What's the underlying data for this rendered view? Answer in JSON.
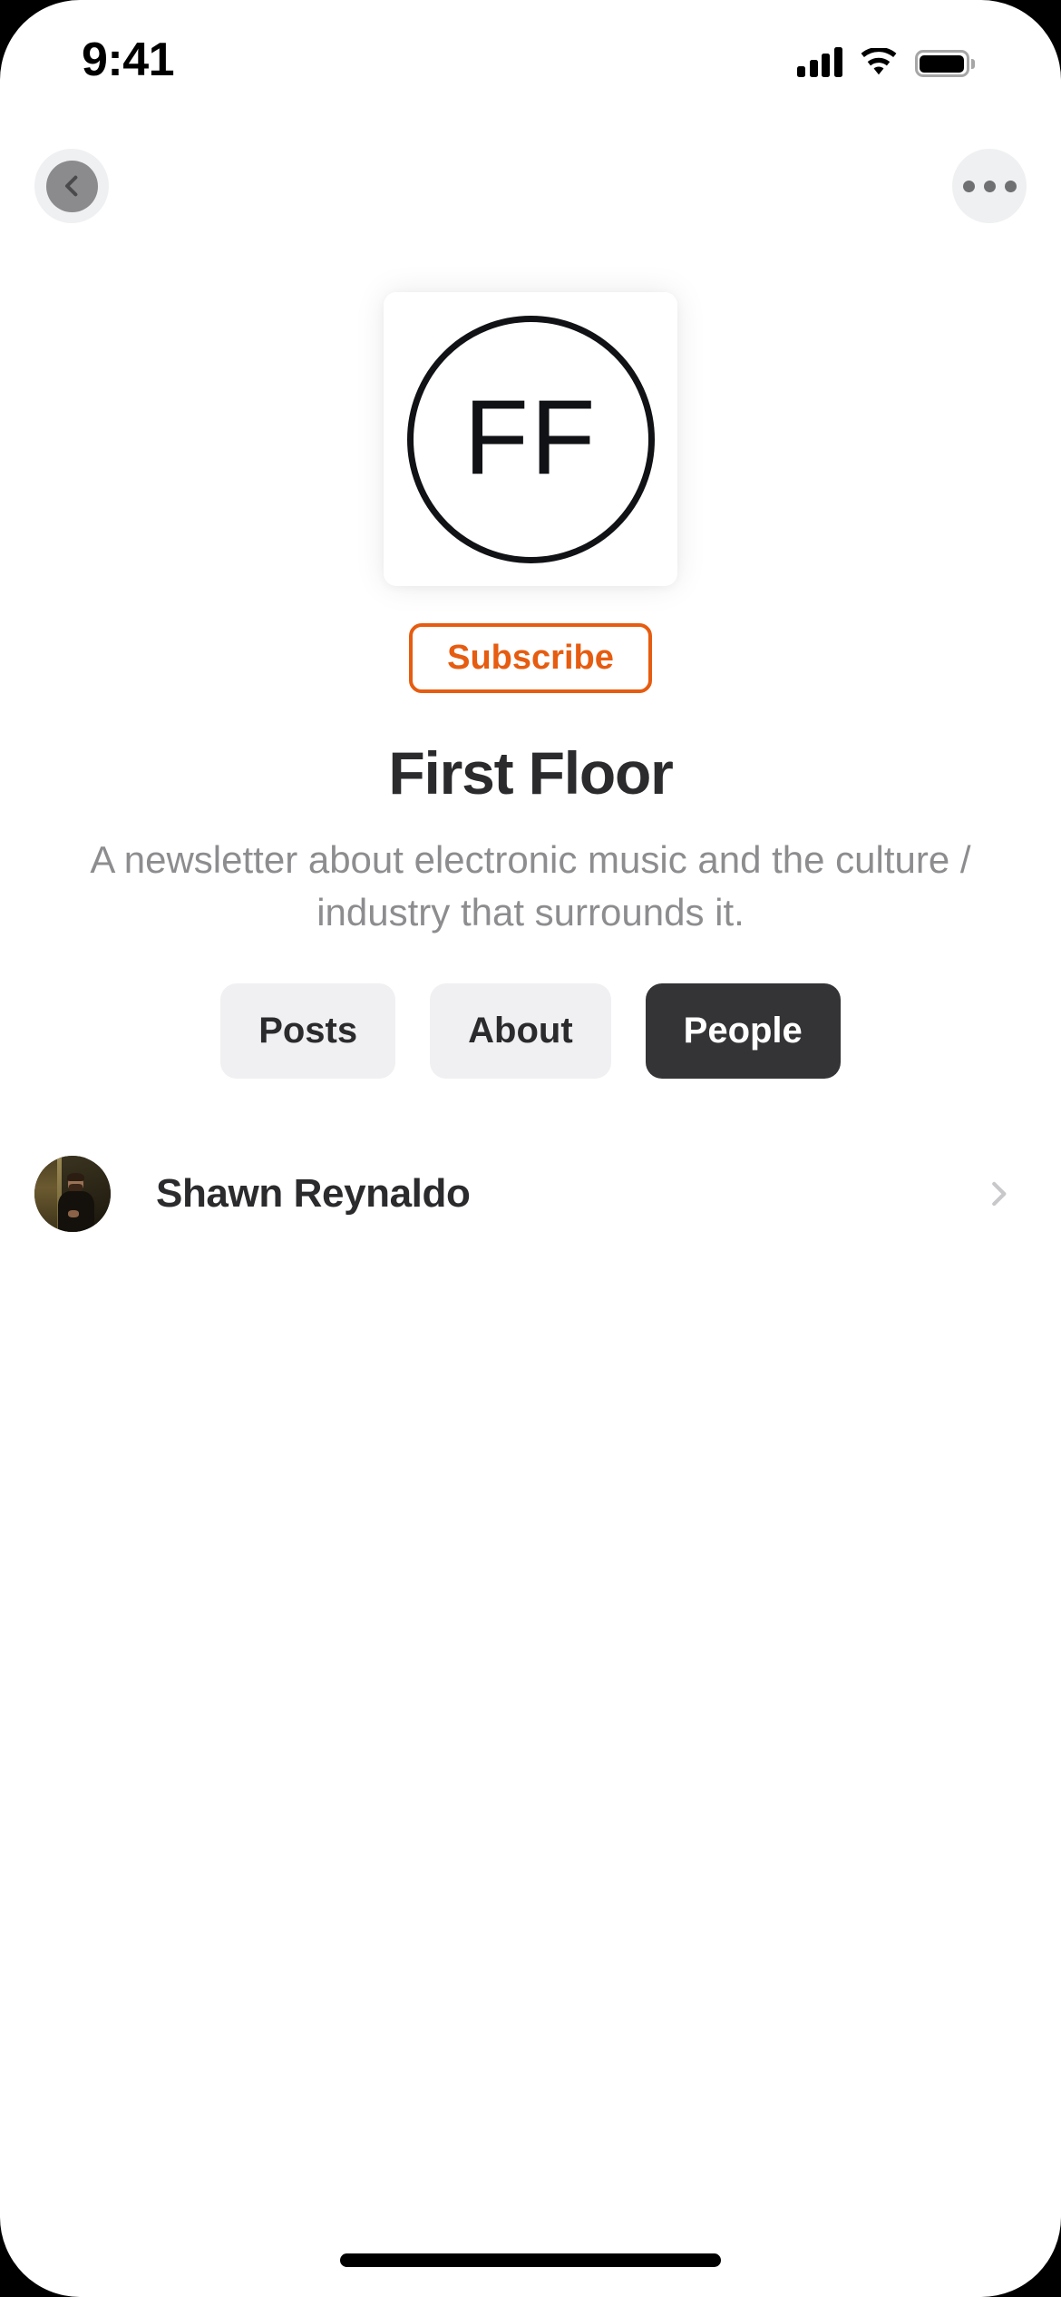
{
  "status_bar": {
    "time": "9:41",
    "cellular_icon": "cellular-signal-icon",
    "wifi_icon": "wifi-icon",
    "battery_icon": "battery-full-icon"
  },
  "nav": {
    "back_icon": "chevron-left-icon",
    "more_icon": "ellipsis-icon"
  },
  "publication": {
    "logo_text": "FF",
    "subscribe_label": "Subscribe",
    "title": "First Floor",
    "description": "A newsletter about electronic music and the culture / industry that surrounds it."
  },
  "tabs": [
    {
      "label": "Posts",
      "active": false
    },
    {
      "label": "About",
      "active": false
    },
    {
      "label": "People",
      "active": true
    }
  ],
  "people": [
    {
      "name": "Shawn Reynaldo",
      "avatar_icon": "person-avatar-photo",
      "disclosure_icon": "chevron-right-icon"
    }
  ],
  "colors": {
    "accent_orange": "#e65c10",
    "active_tab_bg": "#343437",
    "tab_bg": "#f0f0f2",
    "title_text": "#2b2b2d",
    "muted_text": "#8d8d90",
    "chevron_gray": "#c8c8cb",
    "nav_button_bg": "#eff0f1"
  }
}
